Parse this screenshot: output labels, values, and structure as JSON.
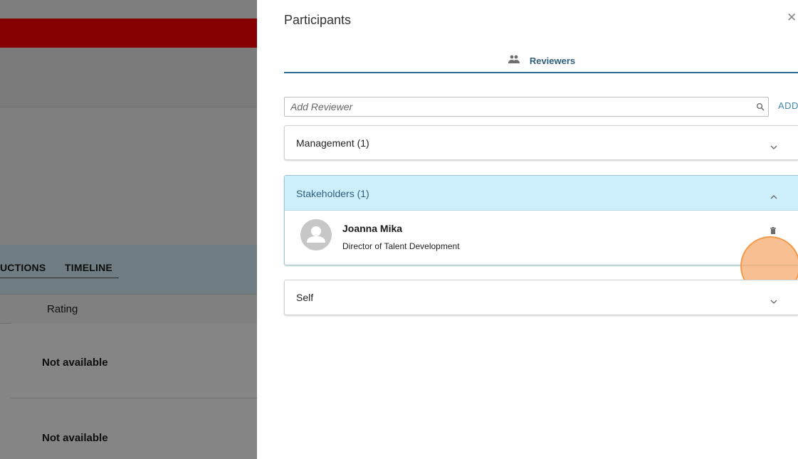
{
  "background": {
    "tabs": [
      "UCTIONS",
      "TIMELINE"
    ],
    "table_header": "Rating",
    "rows": [
      "Not available",
      "Not available"
    ]
  },
  "drawer": {
    "title": "Participants",
    "close_icon": "close-icon",
    "tab": {
      "label": "Reviewers",
      "icon": "people-icon"
    },
    "search": {
      "placeholder": "Add Reviewer",
      "value": "",
      "add_label": "ADD"
    },
    "groups": [
      {
        "title": "Management (1)",
        "expanded": false
      },
      {
        "title": "Stakeholders (1)",
        "expanded": true,
        "members": [
          {
            "name": "Joanna Mika",
            "role": "Director of Talent Development"
          }
        ]
      },
      {
        "title": "Self",
        "expanded": false
      }
    ]
  },
  "colors": {
    "accent": "#2d5f7c",
    "expanded_header_bg": "#cdeefb",
    "brand_red": "#ff0000",
    "highlight": "#f29a4a"
  }
}
